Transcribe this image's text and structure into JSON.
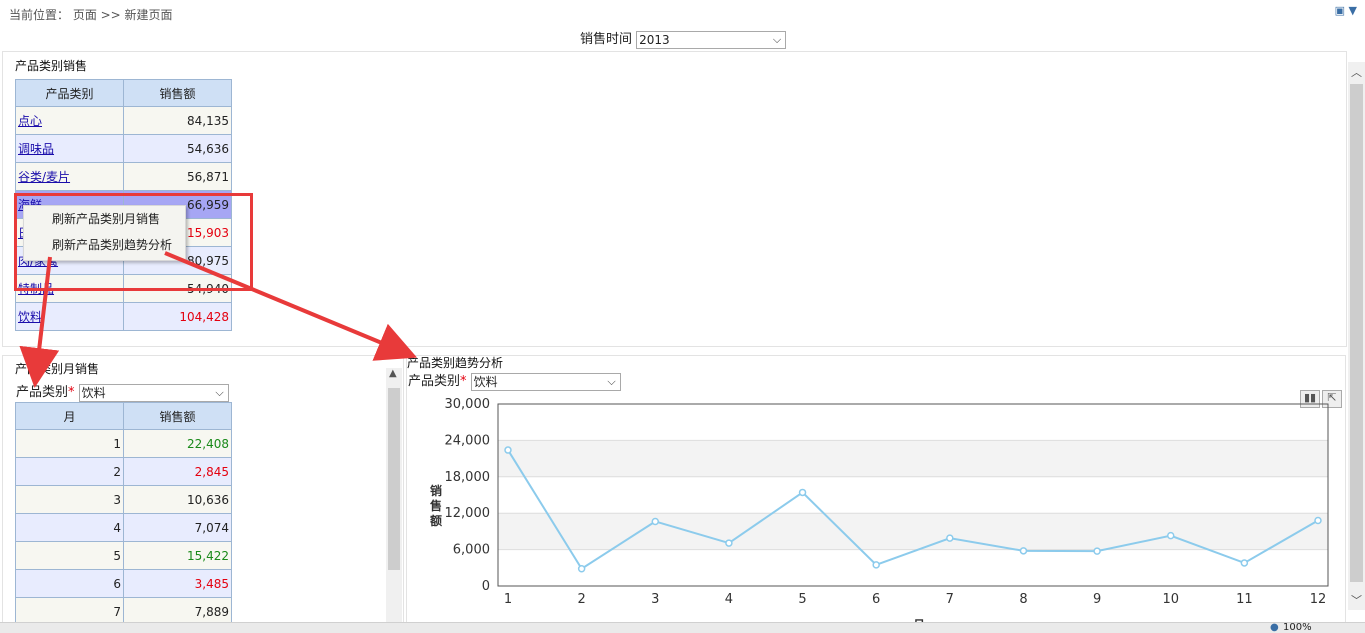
{
  "breadcrumb": "当前位置：  页面 >> 新建页面",
  "filter": {
    "label": "销售时间",
    "value": "2013"
  },
  "category_sales": {
    "title": "产品类别销售",
    "headers": [
      "产品类别",
      "销售额"
    ],
    "rows": [
      {
        "name": "点心",
        "value": "84,135",
        "tone": "normal"
      },
      {
        "name": "调味品",
        "value": "54,636",
        "tone": "normal"
      },
      {
        "name": "谷类/麦片",
        "value": "56,871",
        "tone": "normal"
      },
      {
        "name": "海鲜",
        "value": "66,959",
        "tone": "selected"
      },
      {
        "name": "日用品",
        "value": "115,903",
        "tone": "red"
      },
      {
        "name": "肉/家禽",
        "value": "80,975",
        "tone": "normal"
      },
      {
        "name": "特制品",
        "value": "54,940",
        "tone": "normal"
      },
      {
        "name": "饮料",
        "value": "104,428",
        "tone": "red"
      }
    ]
  },
  "context_menu": {
    "items": [
      "刷新产品类别月销售",
      "刷新产品类别趋势分析"
    ]
  },
  "monthly_sales": {
    "title": "产品类别月销售",
    "filter_label": "产品类别",
    "filter_value": "饮料",
    "headers": [
      "月",
      "销售额"
    ],
    "rows": [
      {
        "month": "1",
        "value": "22,408",
        "tone": "green"
      },
      {
        "month": "2",
        "value": "2,845",
        "tone": "red"
      },
      {
        "month": "3",
        "value": "10,636",
        "tone": "normal"
      },
      {
        "month": "4",
        "value": "7,074",
        "tone": "normal"
      },
      {
        "month": "5",
        "value": "15,422",
        "tone": "green"
      },
      {
        "month": "6",
        "value": "3,485",
        "tone": "red"
      },
      {
        "month": "7",
        "value": "7,889",
        "tone": "normal"
      }
    ]
  },
  "trend": {
    "title": "产品类别趋势分析",
    "filter_label": "产品类别",
    "filter_value": "饮料"
  },
  "chart_data": {
    "type": "line",
    "title": "",
    "ylabel": "销售额",
    "xlabel": "月",
    "categories": [
      "1",
      "2",
      "3",
      "4",
      "5",
      "6",
      "7",
      "8",
      "9",
      "10",
      "11",
      "12"
    ],
    "values": [
      22408,
      2845,
      10636,
      7074,
      15422,
      3485,
      7889,
      5800,
      5750,
      8300,
      3800,
      10800
    ],
    "ylim": [
      0,
      30000
    ],
    "yticks": [
      "0",
      "6,000",
      "12,000",
      "18,000",
      "24,000",
      "30,000"
    ],
    "line_color": "#8ccbec"
  },
  "status": {
    "zoom": "100%"
  }
}
